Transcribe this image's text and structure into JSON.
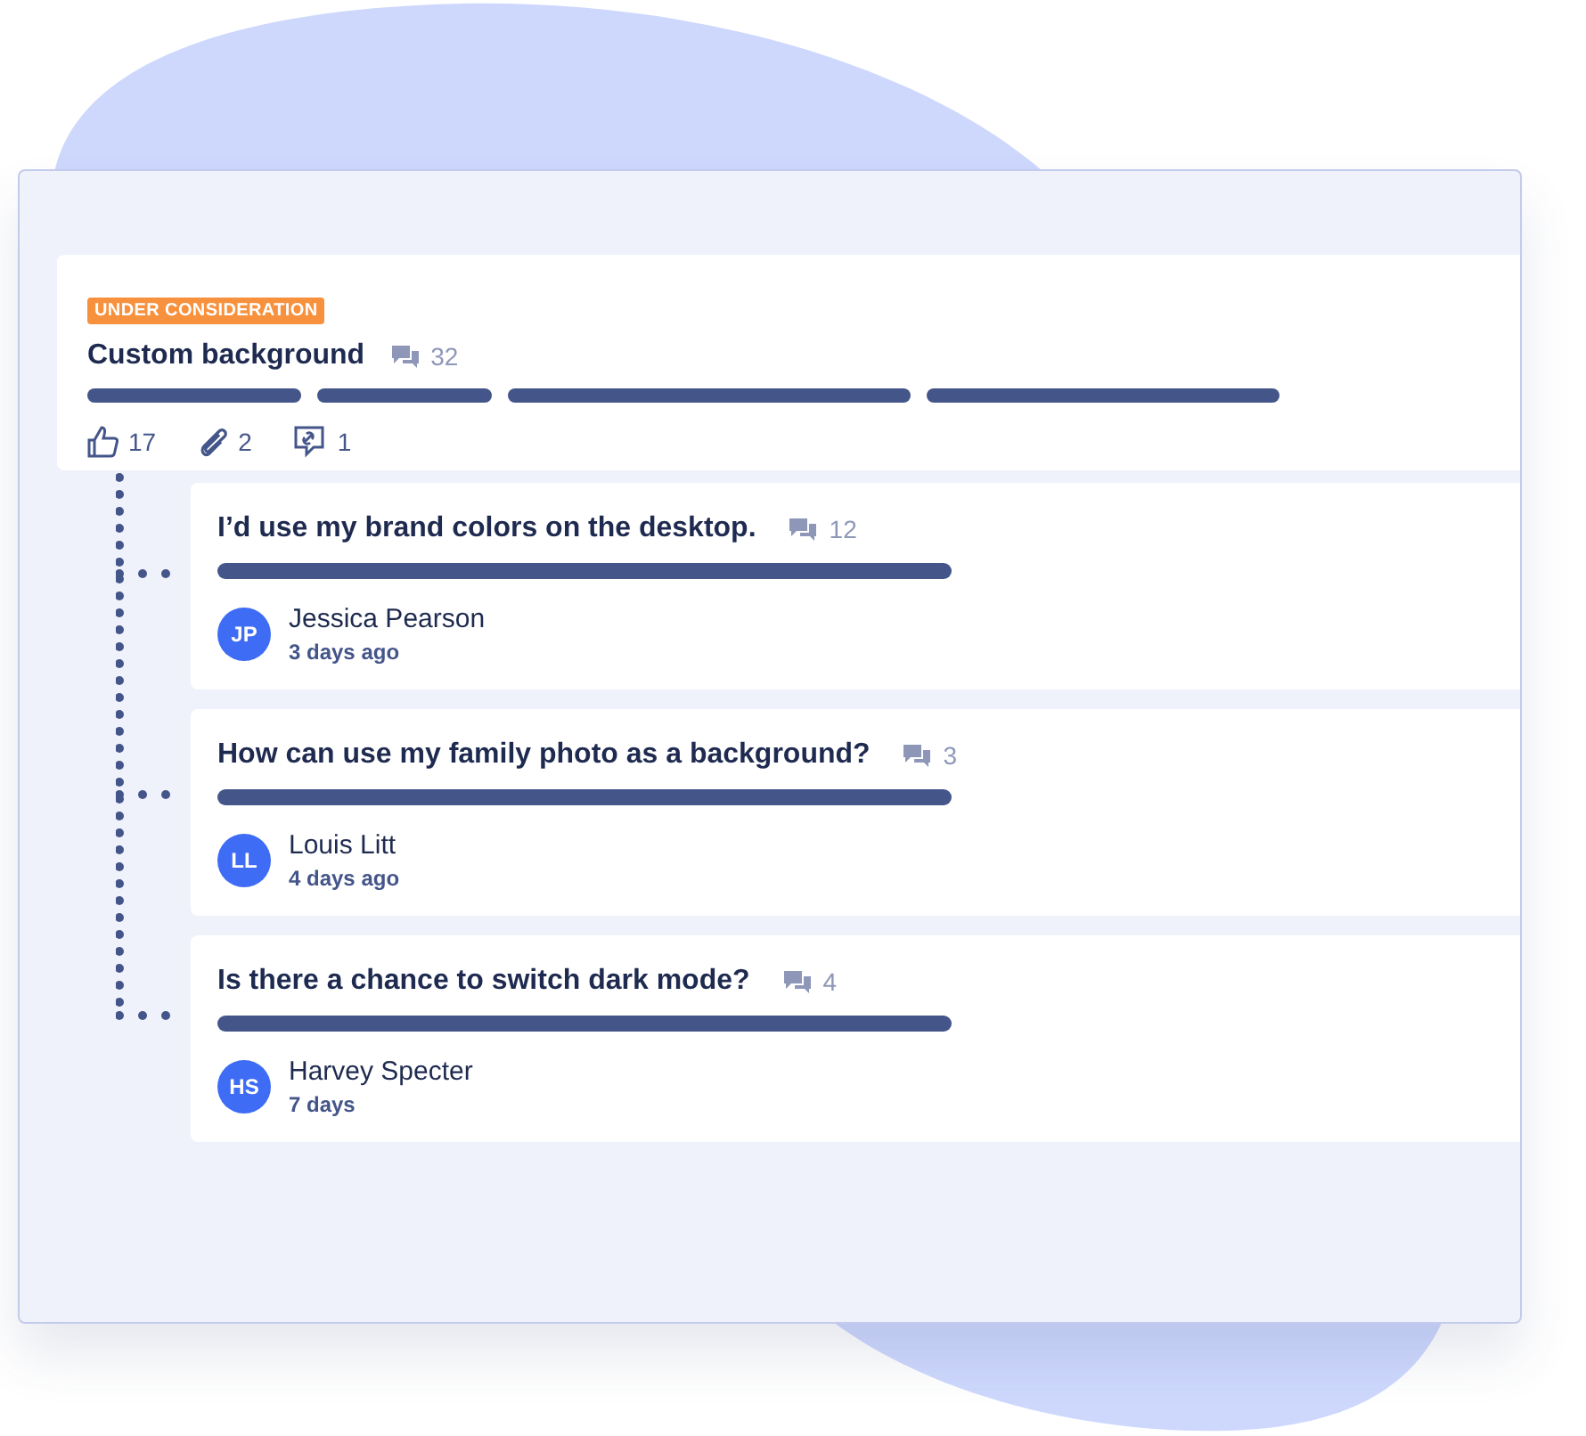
{
  "idea": {
    "status": "UNDER CONSIDERATION",
    "title": "Custom background",
    "comments": "32",
    "likes": "17",
    "attachments": "2",
    "links": "1"
  },
  "replies": [
    {
      "title": "I’d use my brand colors on the desktop.",
      "comments": "12",
      "initials": "JP",
      "author": "Jessica Pearson",
      "time": "3 days ago"
    },
    {
      "title": "How can use my family photo as a background?",
      "comments": "3",
      "initials": "LL",
      "author": "Louis Litt",
      "time": "4 days ago"
    },
    {
      "title": "Is there a chance to switch dark mode?",
      "comments": "4",
      "initials": "HS",
      "author": "Harvey Specter",
      "time": "7 days"
    }
  ]
}
